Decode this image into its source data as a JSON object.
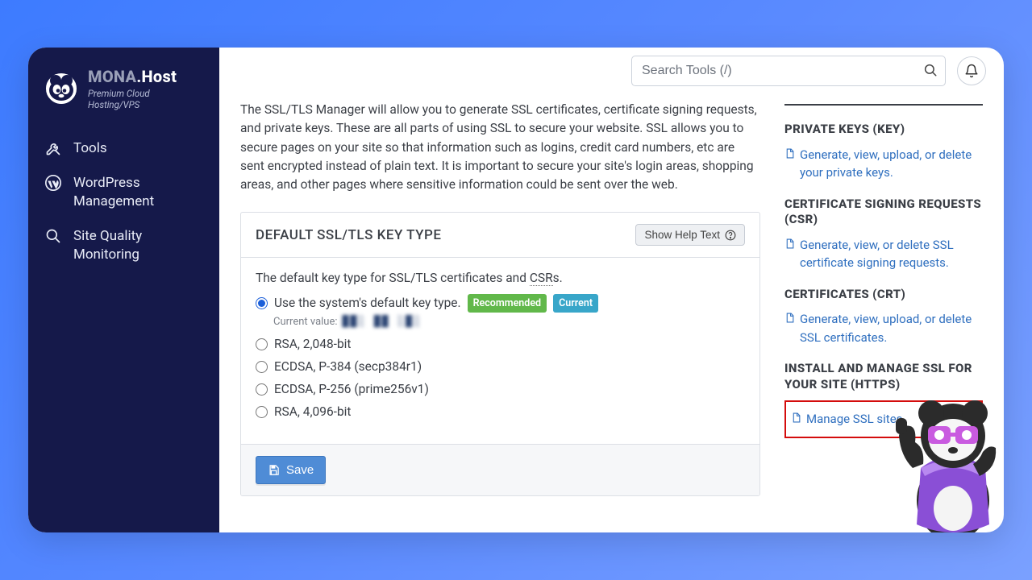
{
  "brand": {
    "part1": "MONA",
    "part2": ".Host",
    "tagline": "Premium Cloud Hosting/VPS"
  },
  "sidebar": {
    "items": [
      {
        "label": "Tools"
      },
      {
        "label": "WordPress Management"
      },
      {
        "label": "Site Quality Monitoring"
      }
    ]
  },
  "search": {
    "placeholder": "Search Tools (/)"
  },
  "intro": "The SSL/TLS Manager will allow you to generate SSL certificates, certificate signing requests, and private keys. These are all parts of using SSL to secure your website. SSL allows you to secure pages on your site so that information such as logins, credit card numbers, etc are sent encrypted instead of plain text. It is important to secure your site's login areas, shopping areas, and other pages where sensitive information could be sent over the web.",
  "panel": {
    "title": "DEFAULT SSL/TLS KEY TYPE",
    "help": "Show Help Text",
    "lead_pre": "The default key type for SSL/TLS certificates and ",
    "lead_csr": "CSR",
    "lead_post": "s.",
    "options": [
      {
        "label": "Use the system's default key type.",
        "recommended": "Recommended",
        "current": "Current"
      },
      {
        "label": "RSA, 2,048-bit"
      },
      {
        "label": "ECDSA, P-384 (secp384r1)"
      },
      {
        "label": "ECDSA, P-256 (prime256v1)"
      },
      {
        "label": "RSA, 4,096-bit"
      }
    ],
    "current_value_label": "Current value:",
    "current_value_blur": "██░  ██ ░█░",
    "save": "Save"
  },
  "right": {
    "sections": [
      {
        "title": "PRIVATE KEYS (KEY)",
        "link": "Generate, view, upload, or delete your private keys."
      },
      {
        "title": "CERTIFICATE SIGNING REQUESTS (CSR)",
        "link": "Generate, view, or delete SSL certificate signing requests."
      },
      {
        "title": "CERTIFICATES (CRT)",
        "link": "Generate, view, upload, or delete SSL certificates."
      },
      {
        "title": "INSTALL AND MANAGE SSL FOR YOUR SITE (HTTPS)",
        "link": "Manage SSL sites.",
        "highlighted": true
      }
    ]
  }
}
